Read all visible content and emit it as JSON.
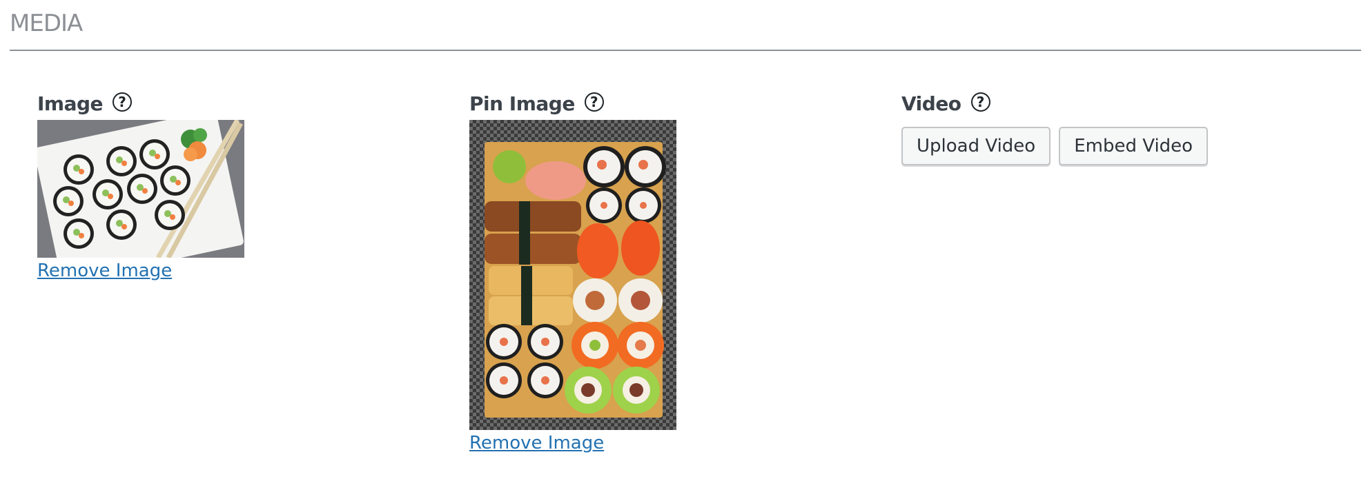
{
  "section": {
    "title": "MEDIA"
  },
  "image_field": {
    "label": "Image",
    "help_icon": "?",
    "thumbnail": "sushi-rolls-on-white-plate-with-chopsticks",
    "remove_label": "Remove Image"
  },
  "pin_image_field": {
    "label": "Pin Image",
    "help_icon": "?",
    "thumbnail": "sushi-platter-on-wooden-board",
    "remove_label": "Remove Image"
  },
  "video_field": {
    "label": "Video",
    "help_icon": "?",
    "upload_label": "Upload Video",
    "embed_label": "Embed Video"
  },
  "colors": {
    "link": "#2271b1",
    "label": "#3c434a",
    "section_title": "#8c8f94",
    "button_bg": "#f6f7f7",
    "button_border": "#c3c4c7"
  }
}
